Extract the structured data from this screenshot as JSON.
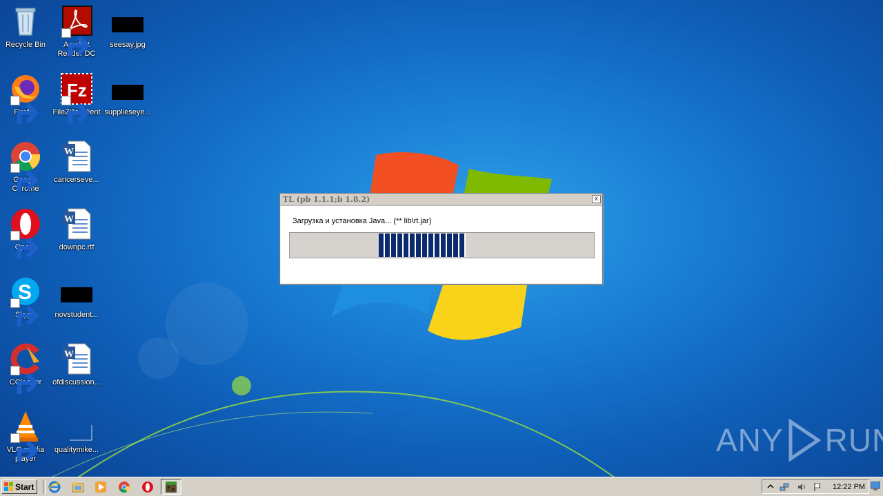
{
  "desktop": {
    "icons": [
      {
        "label": "Recycle Bin",
        "icon": "recycle-bin-icon"
      },
      {
        "label": "Acrobat Reader DC",
        "icon": "acrobat-reader-icon"
      },
      {
        "label": "seesay.jpg",
        "icon": "image-file-icon"
      },
      {
        "label": "Firefox",
        "icon": "firefox-icon"
      },
      {
        "label": "FileZilla Client",
        "icon": "filezilla-icon"
      },
      {
        "label": "supplieseye...",
        "icon": "image-file-icon"
      },
      {
        "label": "Google Chrome",
        "icon": "chrome-icon"
      },
      {
        "label": "cancerseve...",
        "icon": "word-document-icon"
      },
      {
        "label": "Opera",
        "icon": "opera-icon"
      },
      {
        "label": "downpc.rtf",
        "icon": "word-document-icon"
      },
      {
        "label": "Skype",
        "icon": "skype-icon"
      },
      {
        "label": "novstudent...",
        "icon": "image-file-icon"
      },
      {
        "label": "CCleaner",
        "icon": "ccleaner-icon"
      },
      {
        "label": "ofdiscussion...",
        "icon": "word-document-icon"
      },
      {
        "label": "VLC media player",
        "icon": "vlc-icon"
      },
      {
        "label": "qualitymike...",
        "icon": "blank-file-icon"
      }
    ]
  },
  "dialog": {
    "title": "TL (pb 1.1.1;b 1.8.2)",
    "close_label": "x",
    "message": "Загрузка и установка Java... (** lib\\rt.jar)",
    "progress": {
      "style": "marquee",
      "fill_color": "#0c2a6e"
    }
  },
  "taskbar": {
    "start_label": "Start",
    "pinned": [
      "internet-explorer-icon",
      "file-explorer-icon",
      "media-player-icon",
      "chrome-icon",
      "opera-icon",
      "minecraft-icon"
    ],
    "clock": "12:22 PM"
  },
  "watermark": {
    "left": "ANY",
    "right": "RUN"
  }
}
